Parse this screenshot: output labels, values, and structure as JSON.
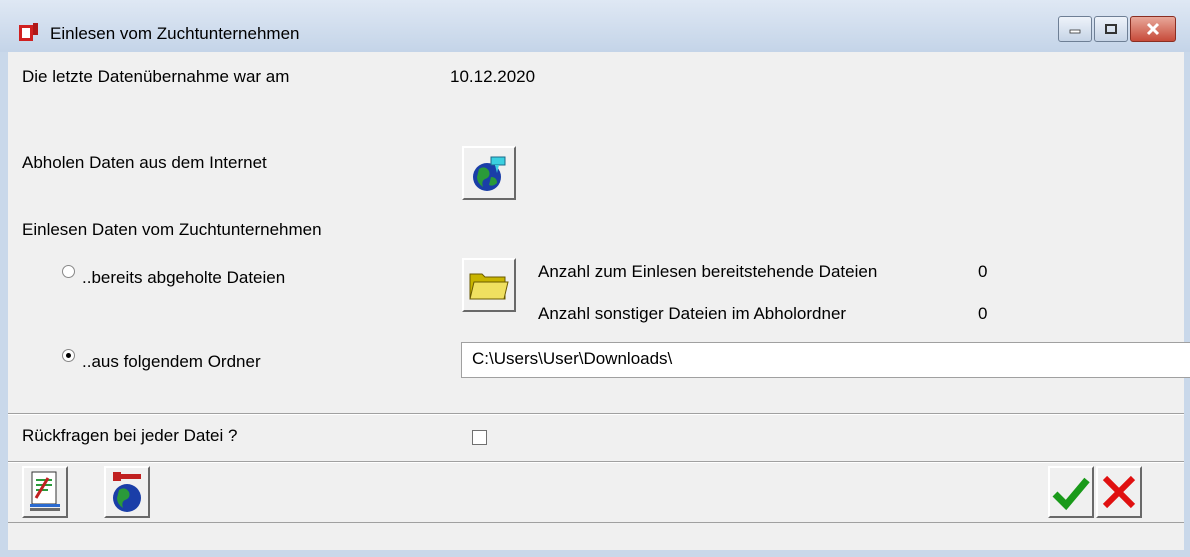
{
  "window": {
    "title": "Einlesen vom Zuchtunternehmen"
  },
  "last_import": {
    "label": "Die letzte Datenübernahme war am",
    "date": "10.12.2020"
  },
  "fetch": {
    "label": "Abholen Daten aus dem Internet"
  },
  "import": {
    "label": "Einlesen Daten vom Zuchtunternehmen",
    "option_fetched": {
      "label": "..bereits abgeholte Dateien",
      "selected": false
    },
    "option_folder": {
      "label": "..aus folgendem Ordner",
      "selected": true
    },
    "count_ready_label": "Anzahl zum Einlesen bereitstehende Dateien",
    "count_ready_value": "0",
    "count_other_label": "Anzahl sonstiger Dateien im Abholordner",
    "count_other_value": "0",
    "folder_path": "C:\\Users\\User\\Downloads\\"
  },
  "confirm": {
    "label": "Rückfragen bei jeder Datei ?",
    "checked": false
  },
  "colors": {
    "ok": "#1a9a1a",
    "cancel": "#e01010",
    "titlebar": "#c9d8ea"
  }
}
